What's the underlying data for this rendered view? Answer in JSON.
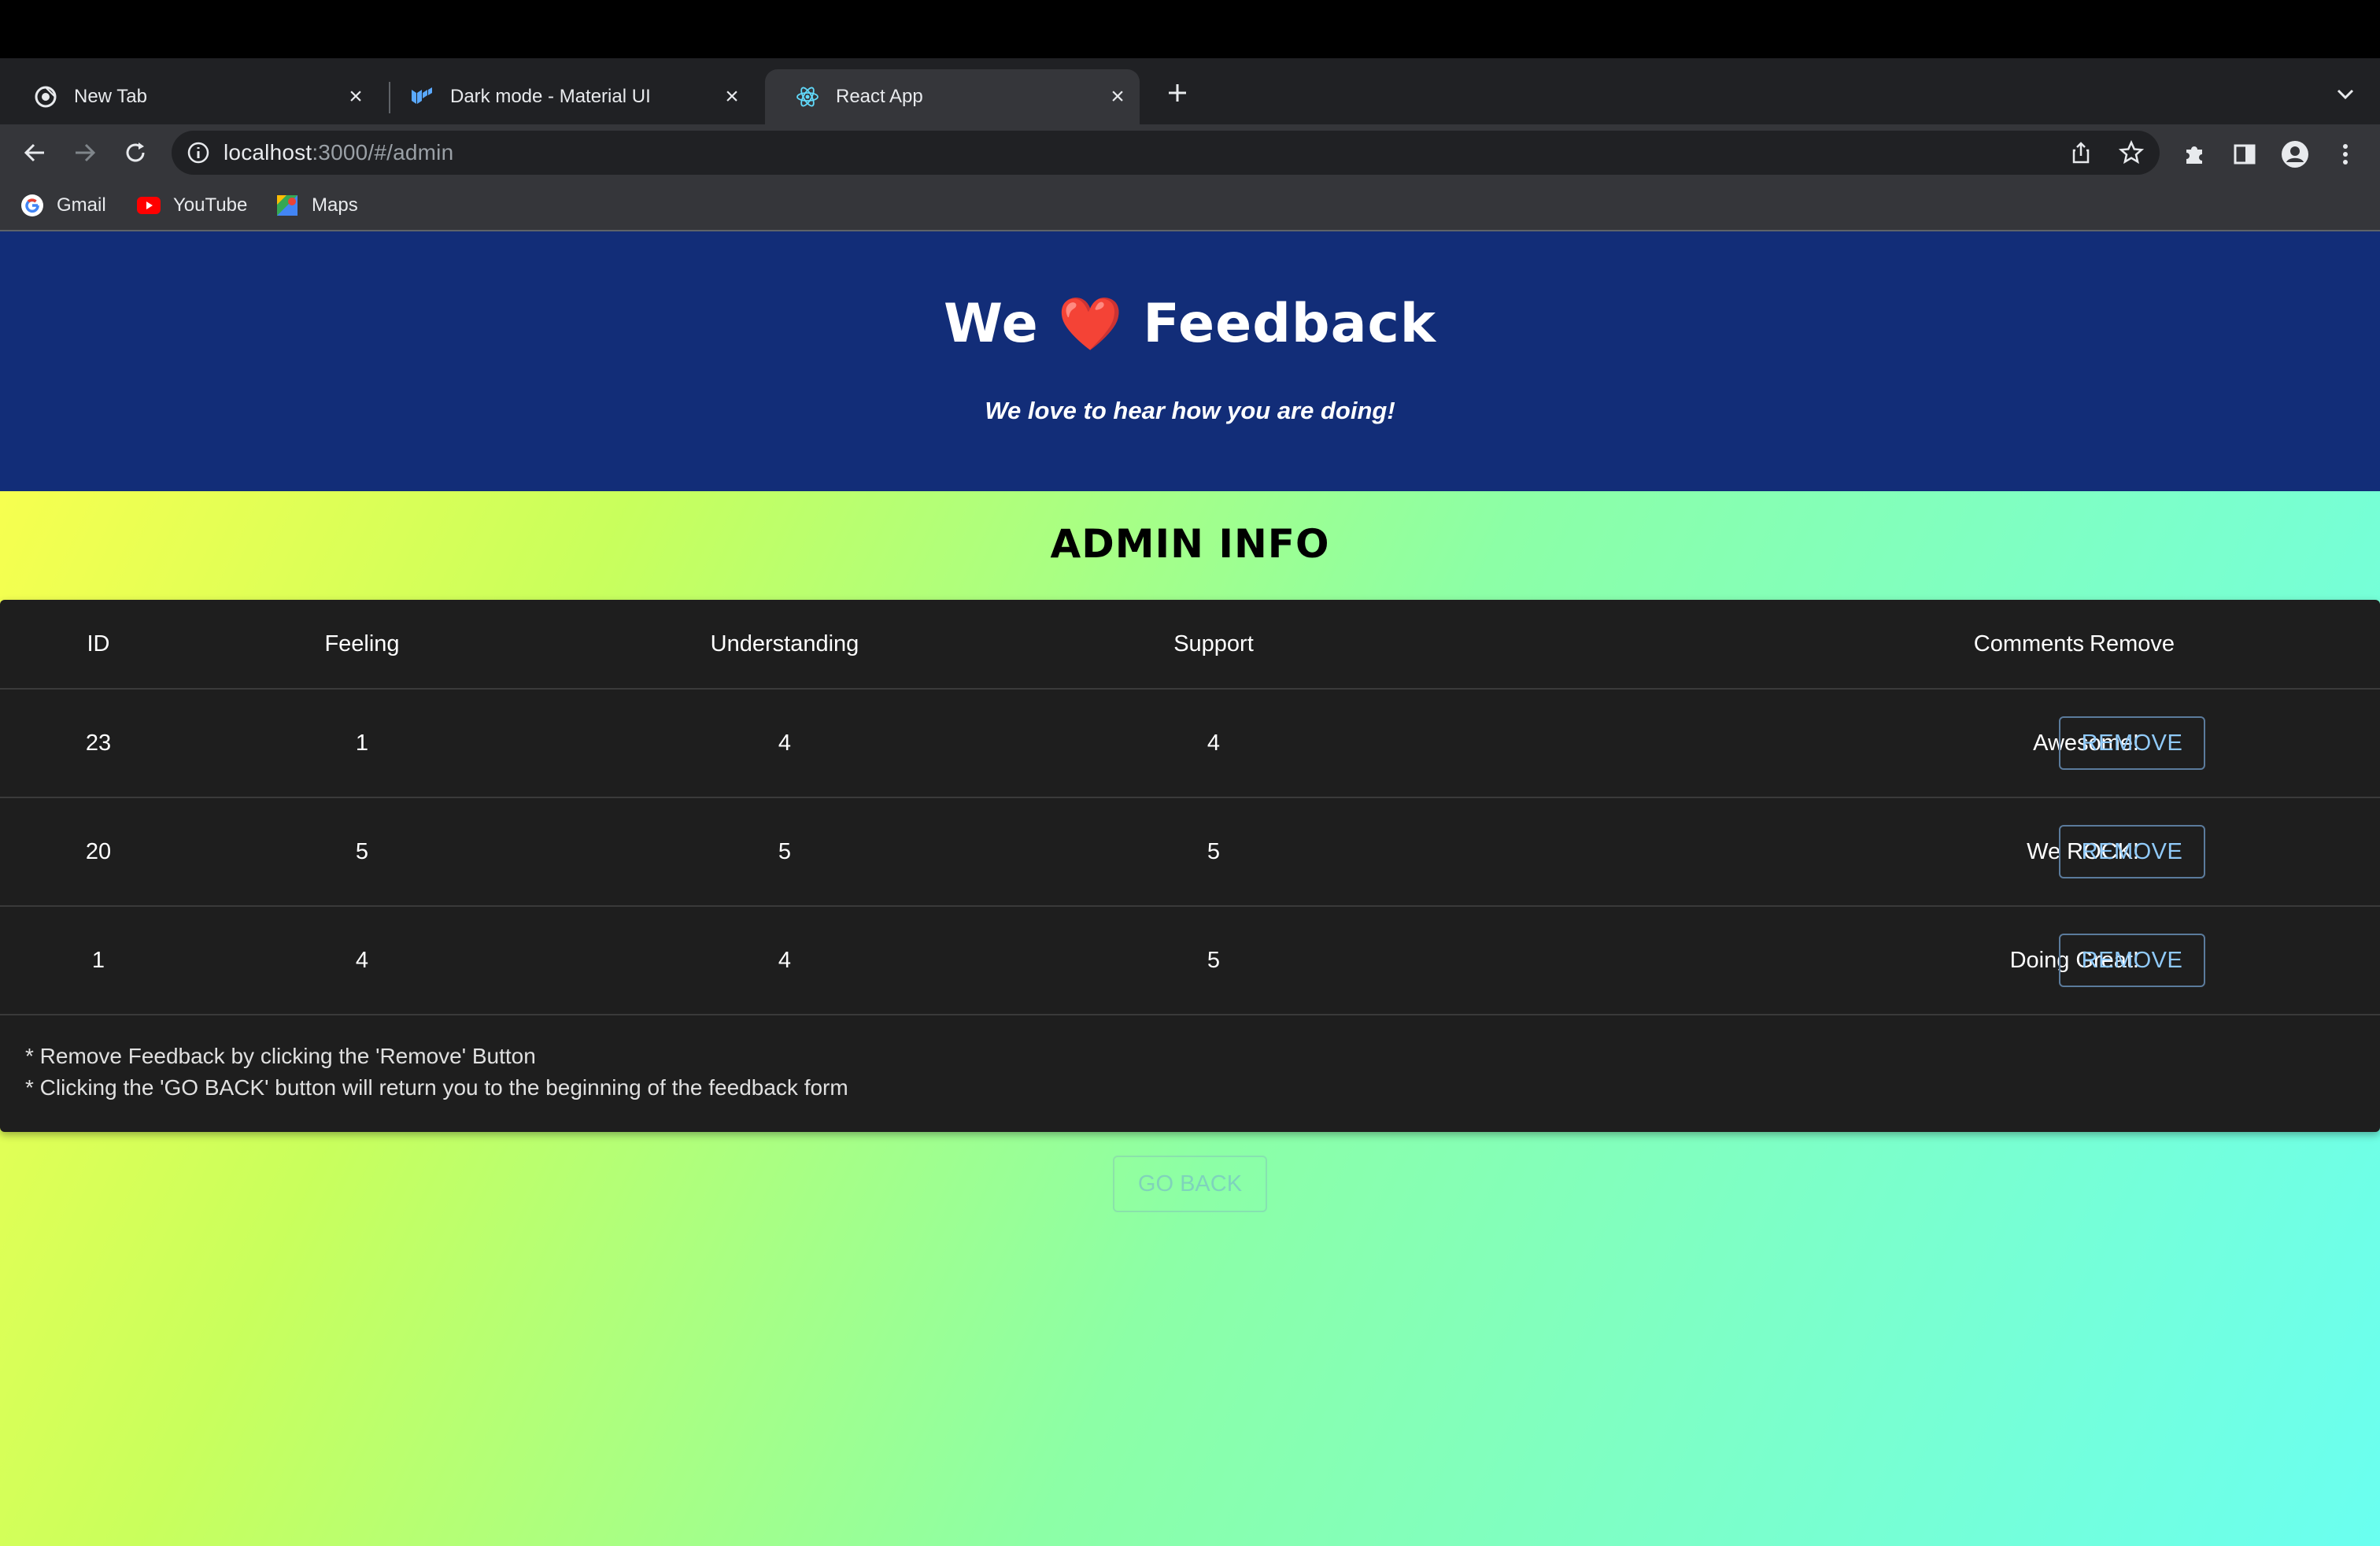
{
  "browser": {
    "tabs": [
      {
        "title": "New Tab",
        "favicon": "chrome-icon"
      },
      {
        "title": "Dark mode - Material UI",
        "favicon": "mui-icon"
      },
      {
        "title": "React App",
        "favicon": "react-icon",
        "active": true
      }
    ],
    "url": {
      "host": "localhost",
      "path": ":3000/#/admin"
    },
    "bookmarks": [
      {
        "label": "Gmail",
        "icon": "google-icon"
      },
      {
        "label": "YouTube",
        "icon": "youtube-icon"
      },
      {
        "label": "Maps",
        "icon": "maps-icon"
      }
    ]
  },
  "header": {
    "title_left": "We",
    "heart": "❤️",
    "title_right": "Feedback",
    "subtitle": "We love to hear how you are doing!"
  },
  "admin": {
    "title": "ADMIN INFO",
    "columns": [
      "ID",
      "Feeling",
      "Understanding",
      "Support",
      "Comments",
      "Remove"
    ],
    "rows": [
      {
        "id": "23",
        "feeling": "1",
        "understanding": "4",
        "support": "4",
        "comments": "Awesome!",
        "action": "REMOVE"
      },
      {
        "id": "20",
        "feeling": "5",
        "understanding": "5",
        "support": "5",
        "comments": "We ROCK!",
        "action": "REMOVE"
      },
      {
        "id": "1",
        "feeling": "4",
        "understanding": "4",
        "support": "5",
        "comments": "Doing Great!",
        "action": "REMOVE"
      }
    ],
    "notes": [
      "* Remove Feedback by clicking the 'Remove' Button",
      "* Clicking the 'GO BACK' button will return you to the beginning of the feedback form"
    ],
    "go_back": "GO BACK"
  },
  "colors": {
    "header_bg": "#122d78",
    "panel_bg": "#1e1e1e",
    "button_text": "#90caf9"
  }
}
